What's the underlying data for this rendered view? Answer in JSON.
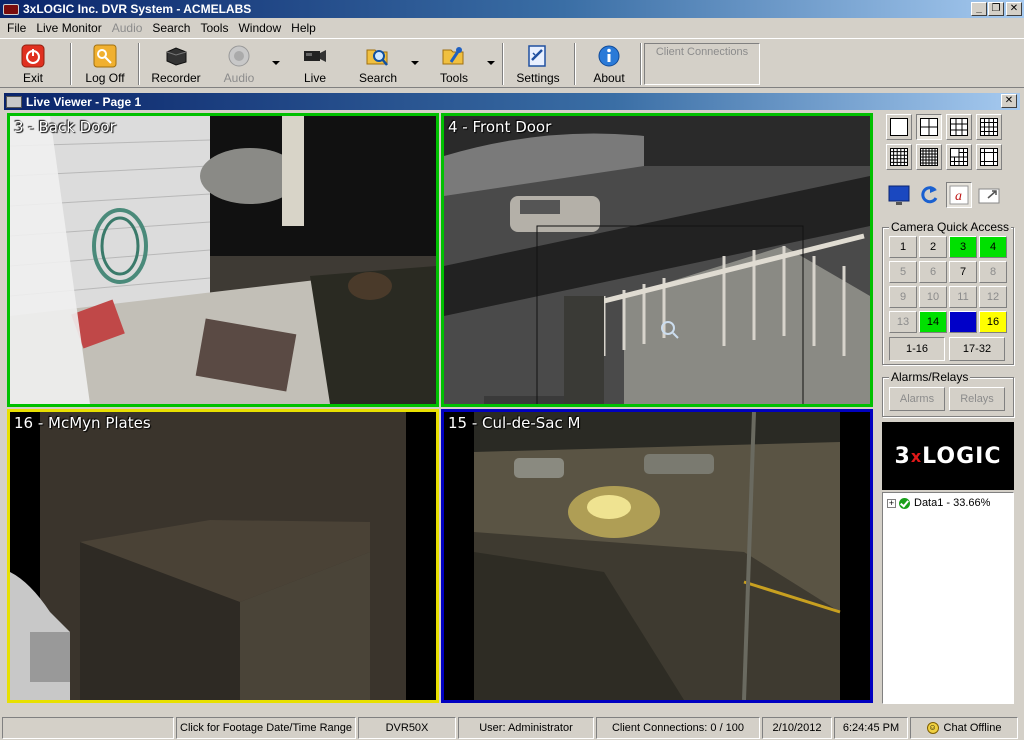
{
  "window": {
    "title": "3xLOGIC Inc. DVR System - ACMELABS"
  },
  "menu": [
    {
      "label": "File",
      "enabled": true
    },
    {
      "label": "Live Monitor",
      "enabled": true
    },
    {
      "label": "Audio",
      "enabled": false
    },
    {
      "label": "Search",
      "enabled": true
    },
    {
      "label": "Tools",
      "enabled": true
    },
    {
      "label": "Window",
      "enabled": true
    },
    {
      "label": "Help",
      "enabled": true
    }
  ],
  "toolbar": {
    "exit": "Exit",
    "logoff": "Log Off",
    "recorder": "Recorder",
    "audio": "Audio",
    "live": "Live",
    "search": "Search",
    "tools": "Tools",
    "settings": "Settings",
    "about": "About",
    "client_connections": "Client Connections"
  },
  "viewer": {
    "title": "Live Viewer - Page 1",
    "cameras": [
      {
        "label": "3 - Back Door",
        "border": "#00c000"
      },
      {
        "label": "4 - Front Door",
        "border": "#00c000"
      },
      {
        "label": "16 - McMyn Plates",
        "border": "#e8e000"
      },
      {
        "label": "15 - Cul-de-Sac M",
        "border": "#0000c0"
      }
    ]
  },
  "panel": {
    "quick_access_title": "Camera Quick Access",
    "quick_access": [
      {
        "n": "1",
        "state": "normal"
      },
      {
        "n": "2",
        "state": "normal"
      },
      {
        "n": "3",
        "state": "green"
      },
      {
        "n": "4",
        "state": "green"
      },
      {
        "n": "5",
        "state": "dim"
      },
      {
        "n": "6",
        "state": "dim"
      },
      {
        "n": "7",
        "state": "normal"
      },
      {
        "n": "8",
        "state": "dim"
      },
      {
        "n": "9",
        "state": "dim"
      },
      {
        "n": "10",
        "state": "dim"
      },
      {
        "n": "11",
        "state": "dim"
      },
      {
        "n": "12",
        "state": "dim"
      },
      {
        "n": "13",
        "state": "dim"
      },
      {
        "n": "14",
        "state": "green"
      },
      {
        "n": "15",
        "state": "blue"
      },
      {
        "n": "16",
        "state": "yellow"
      }
    ],
    "range_1": "1-16",
    "range_2": "17-32",
    "alarms_title": "Alarms/Relays",
    "alarms_btn": "Alarms",
    "relays_btn": "Relays",
    "logo_left": "3",
    "logo_x": "x",
    "logo_right": "LOGIC",
    "tree_item": "Data1 - 33.66%"
  },
  "status": {
    "footage": "Click for Footage Date/Time Range",
    "server": "DVR50X",
    "user": "User: Administrator",
    "connections": "Client Connections: 0 / 100",
    "date": "2/10/2012",
    "time": "6:24:45 PM",
    "chat": "Chat Offline"
  }
}
